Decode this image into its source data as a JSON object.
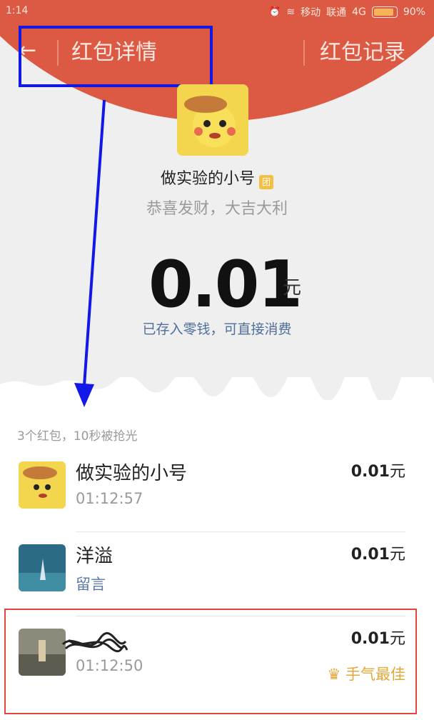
{
  "status_bar": {
    "time": "1:14",
    "carrier1": "移动",
    "carrier2": "联通",
    "network": "4G",
    "battery": "90%"
  },
  "nav": {
    "back_icon": "arrow-left-icon",
    "title": "红包详情",
    "records": "红包记录"
  },
  "sender": {
    "name": "做实验的小号",
    "badge": "团",
    "wishes": "恭喜发财，大吉大利"
  },
  "amount": {
    "value": "0.01",
    "unit": "元",
    "stored_note": "已存入零钱，可直接消费"
  },
  "summary": "3个红包，10秒被抢光",
  "rows": [
    {
      "name": "做实验的小号",
      "sub": "01:12:57",
      "amount": "0.01",
      "unit": "元"
    },
    {
      "name": "洋溢",
      "sub": "留言",
      "amount": "0.01",
      "unit": "元"
    },
    {
      "name": "",
      "sub": "01:12:50",
      "amount": "0.01",
      "unit": "元",
      "best": "手气最佳"
    }
  ],
  "colors": {
    "header_red": "#dc5a43",
    "annotation_blue": "#1218e8",
    "annotation_red": "#e0453f",
    "best_gold": "#e3a73a"
  }
}
